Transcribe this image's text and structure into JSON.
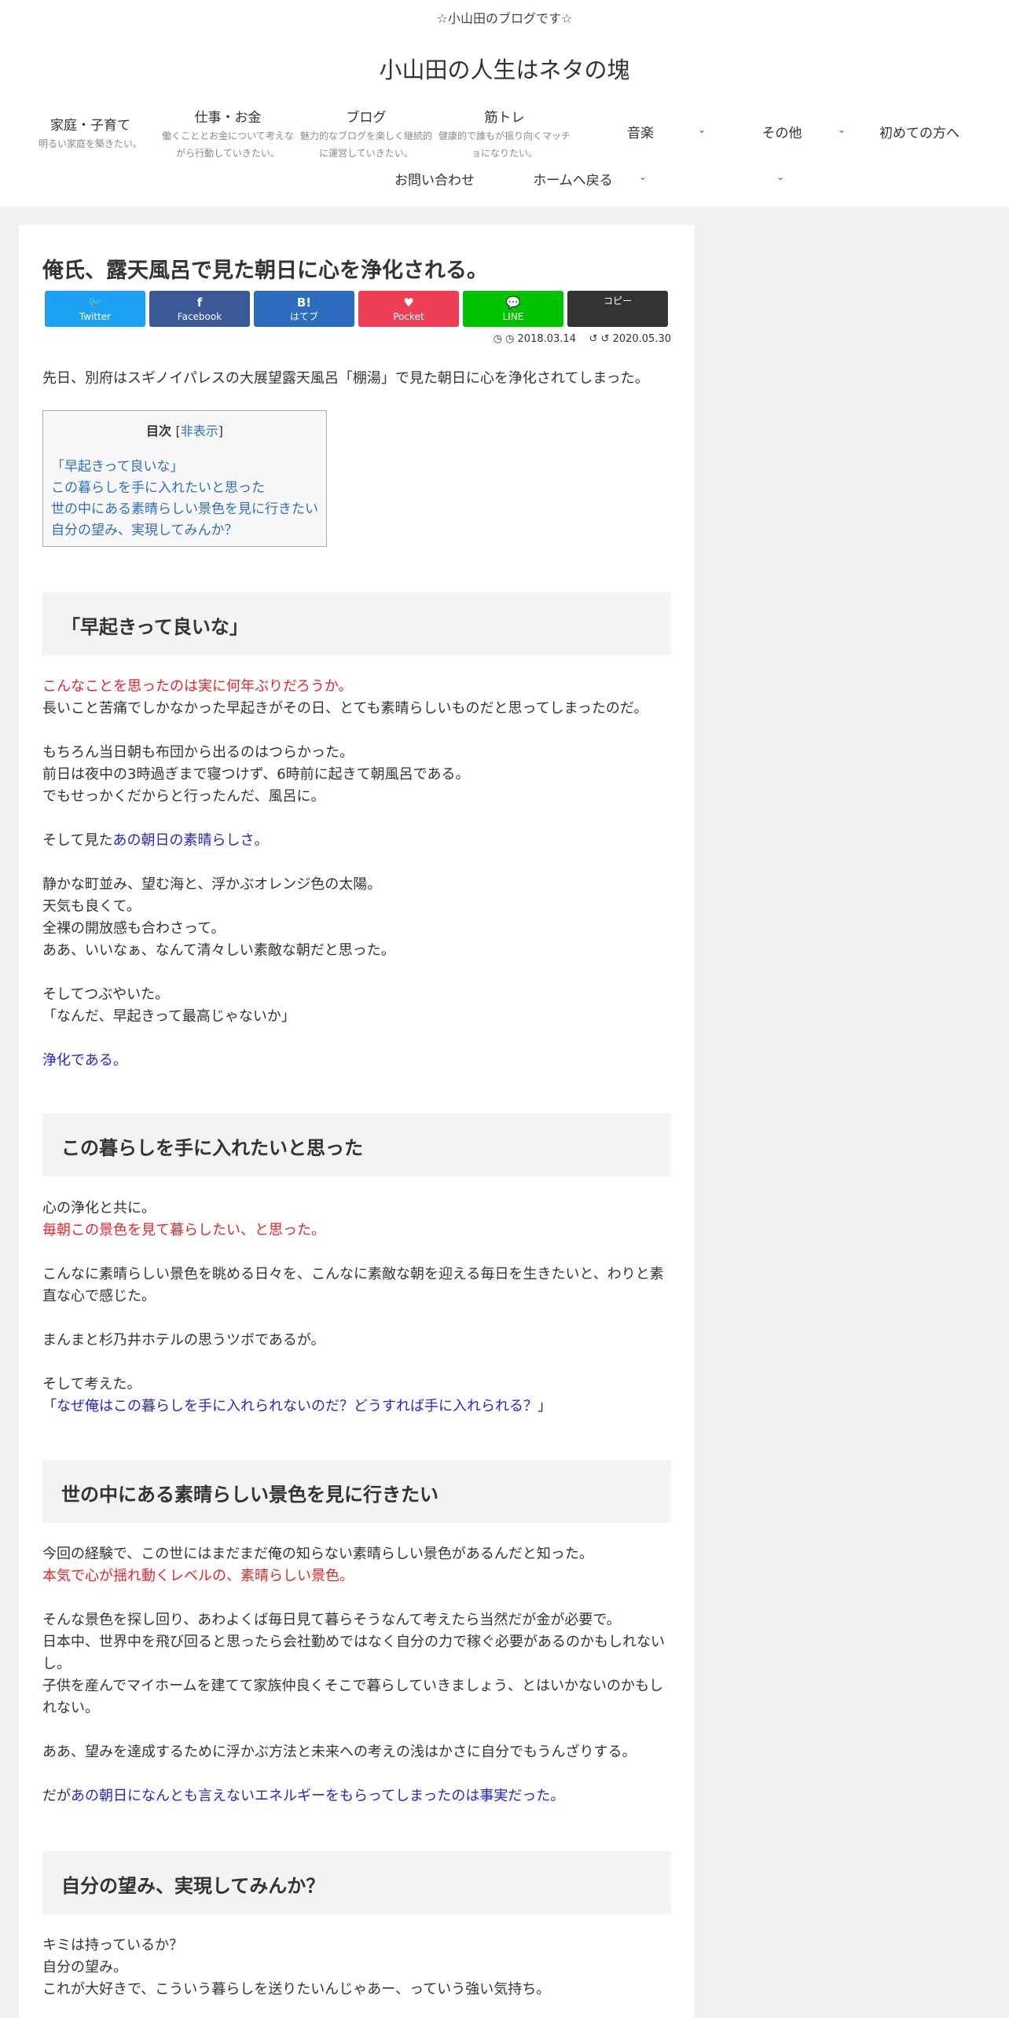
{
  "header": {
    "tagline": "☆小山田のブログです☆",
    "site_title": "小山田の人生はネタの塊"
  },
  "nav": {
    "items": [
      {
        "label": "家庭・子育て",
        "desc": [
          "明るい家庭を築きたい。"
        ]
      },
      {
        "label": "仕事・お金",
        "desc": [
          "働くこととお金について考えな",
          "がら行動していきたい。"
        ]
      },
      {
        "label": "ブログ",
        "desc": [
          "魅力的なブログを楽しく継続的",
          "に運営していきたい。"
        ]
      },
      {
        "label": "筋トレ",
        "desc": [
          "健康的で誰もが振り向くマッチ",
          "ョになりたい。"
        ]
      },
      {
        "label": "音楽",
        "desc": []
      },
      {
        "label": "その他",
        "desc": []
      },
      {
        "label": "初めての方へ",
        "desc": []
      },
      {
        "label": "お問い合わせ",
        "desc": []
      },
      {
        "label": "ホームへ戻る",
        "desc": []
      }
    ],
    "chevron": "⌄"
  },
  "post": {
    "title": "俺氏、露天風呂で見た朝日に心を浄化される。",
    "share": [
      {
        "icon": "🐦",
        "icon_name": "twitter-icon",
        "label": "Twitter",
        "color": "#1da1f2"
      },
      {
        "icon": "f",
        "icon_name": "facebook-icon",
        "label": "Facebook",
        "color": "#3b5998"
      },
      {
        "icon": "B!",
        "icon_name": "hatebu-icon",
        "label": "はてブ",
        "color": "#2c6ebd"
      },
      {
        "icon": "♥",
        "icon_name": "pocket-icon",
        "label": "Pocket",
        "color": "#ef3f56"
      },
      {
        "icon": "💬",
        "icon_name": "line-icon",
        "label": "LINE",
        "color": "#00c300"
      },
      {
        "icon": "",
        "icon_name": "copy-icon",
        "label": "コピー",
        "color": "#333333"
      }
    ],
    "published": "2018.03.14",
    "updated": "2020.05.30",
    "intro": "先日、別府はスギノイパレスの大展望露天風呂「棚湯」で見た朝日に心を浄化されてしまった。"
  },
  "toc": {
    "title": "目次",
    "toggle_open": "[",
    "toggle_label": "非表示",
    "toggle_close": "]",
    "items": [
      "「早起きって良いな」",
      "この暮らしを手に入れたいと思った",
      "世の中にある素晴らしい景色を見に行きたい",
      "自分の望み、実現してみんか？"
    ]
  },
  "sections": {
    "s1": {
      "heading": "「早起きって良いな」",
      "l1": "こんなことを思ったのは実に何年ぶりだろうか。",
      "l2": "長いこと苦痛でしかなかった早起きがその日、とても素晴らしいものだと思ってしまったのだ。",
      "l3": "もちろん当日朝も布団から出るのはつらかった。",
      "l4": "前日は夜中の3時過ぎまで寝つけず、6時前に起きて朝風呂である。",
      "l5": "でもせっかくだからと行ったんだ、風呂に。",
      "l6a": "そして見た",
      "l6b": "あの朝日の素晴らしさ。",
      "l7": "静かな町並み、望む海と、浮かぶオレンジ色の太陽。",
      "l8": "天気も良くて。",
      "l9": "全裸の開放感も合わさって。",
      "l10": "ああ、いいなぁ、なんて清々しい素敵な朝だと思った。",
      "l11": "そしてつぶやいた。",
      "l12": "「なんだ、早起きって最高じゃないか」",
      "l13": "浄化である。"
    },
    "s2": {
      "heading": "この暮らしを手に入れたいと思った",
      "l1": "心の浄化と共に。",
      "l2": "毎朝この景色を見て暮らしたい、と思った。",
      "l3": "こんなに素晴らしい景色を眺める日々を、こんなに素敵な朝を迎える毎日を生きたいと、わりと素",
      "l4": "直な心で感じた。",
      "l5": "まんまと杉乃井ホテルの思うツボであるが。",
      "l6": "そして考えた。",
      "l7a": "「",
      "l7b": "なぜ俺はこの暮らしを手に入れられないのだ？どうすれば手に入れられる？",
      "l7c": "」"
    },
    "s3": {
      "heading": "世の中にある素晴らしい景色を見に行きたい",
      "l1": "今回の経験で、この世にはまだまだ俺の知らない素晴らしい景色があるんだと知った。",
      "l2": "本気で心が揺れ動くレベルの、素晴らしい景色。",
      "l3": "そんな景色を探し回り、あわよくば毎日見て暮らそうなんて考えたら当然だが金が必要で。",
      "l4": "日本中、世界中を飛び回ると思ったら会社勤めではなく自分の力で稼ぐ必要があるのかもしれない",
      "l5": "し。",
      "l6": "子供を産んでマイホームを建てて家族仲良くそこで暮らしていきましょう、とはいかないのかもし",
      "l7": "れない。",
      "l8": "ああ、望みを達成するために浮かぶ方法と未来への考えの浅はかさに自分でもうんざりする。",
      "l9a": "だが",
      "l9b": "あの朝日になんとも言えないエネルギーをもらってしまったのは事実だった。"
    },
    "s4": {
      "heading": "自分の望み、実現してみんか？",
      "l1": "キミは持っているか？",
      "l2": "自分の望み。",
      "l3": "これが大好きで、こういう暮らしを送りたいんじゃあー、っていう強い気持ち。"
    }
  }
}
